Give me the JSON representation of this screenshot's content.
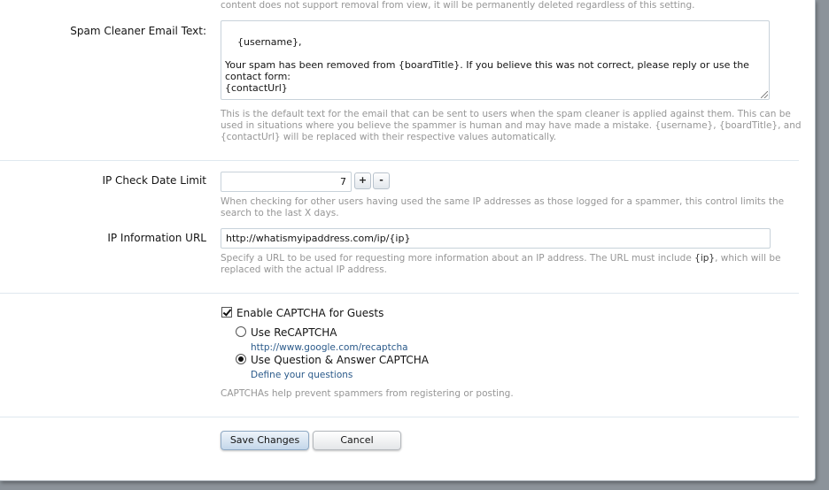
{
  "removal_hint_tail": "content does not support removal from view, it will be permanently deleted regardless of this setting.",
  "spam_email": {
    "label": "Spam Cleaner Email Text:",
    "value": "{username},\n\nYour spam has been removed from {boardTitle}. If you believe this was not correct, please reply or use the contact form:\n{contactUrl}",
    "hint_line1": "This is the default text for the email that can be sent to users when the spam cleaner is applied against them. This can be",
    "hint_line2": "used in situations where you believe the spammer is human and may have made a mistake. {username}, {boardTitle}, and",
    "hint_line3": "{contactUrl} will be replaced with their respective values automatically."
  },
  "ip_check": {
    "label": "IP Check Date Limit",
    "value": "7",
    "increment_label": "+",
    "decrement_label": "-",
    "hint_line1": "When checking for other users having used the same IP addresses as those logged for a spammer, this control limits the",
    "hint_line2": "search to the last X days."
  },
  "ip_url": {
    "label": "IP Information URL",
    "value": "http://whatismyipaddress.com/ip/{ip}",
    "hint_line1_pre": "Specify a URL to be used for requesting more information about an IP address. The URL must include ",
    "hint_line1_token": "{ip}",
    "hint_line1_post": ", which will be",
    "hint_line2": "replaced with the actual IP address."
  },
  "captcha": {
    "enable_label": "Enable CAPTCHA for Guests",
    "enable_checked": true,
    "recaptcha_label": "Use ReCAPTCHA",
    "recaptcha_link": "http://www.google.com/recaptcha",
    "qa_label": "Use Question & Answer CAPTCHA",
    "qa_link": "Define your questions",
    "selected": "qa",
    "hint": "CAPTCHAs help prevent spammers from registering or posting."
  },
  "buttons": {
    "save": "Save Changes",
    "cancel": "Cancel"
  },
  "colors": {
    "link": "#2b5a8a",
    "hint": "#969696",
    "divider": "#dfe8ef",
    "backdrop": "#8c939a"
  }
}
